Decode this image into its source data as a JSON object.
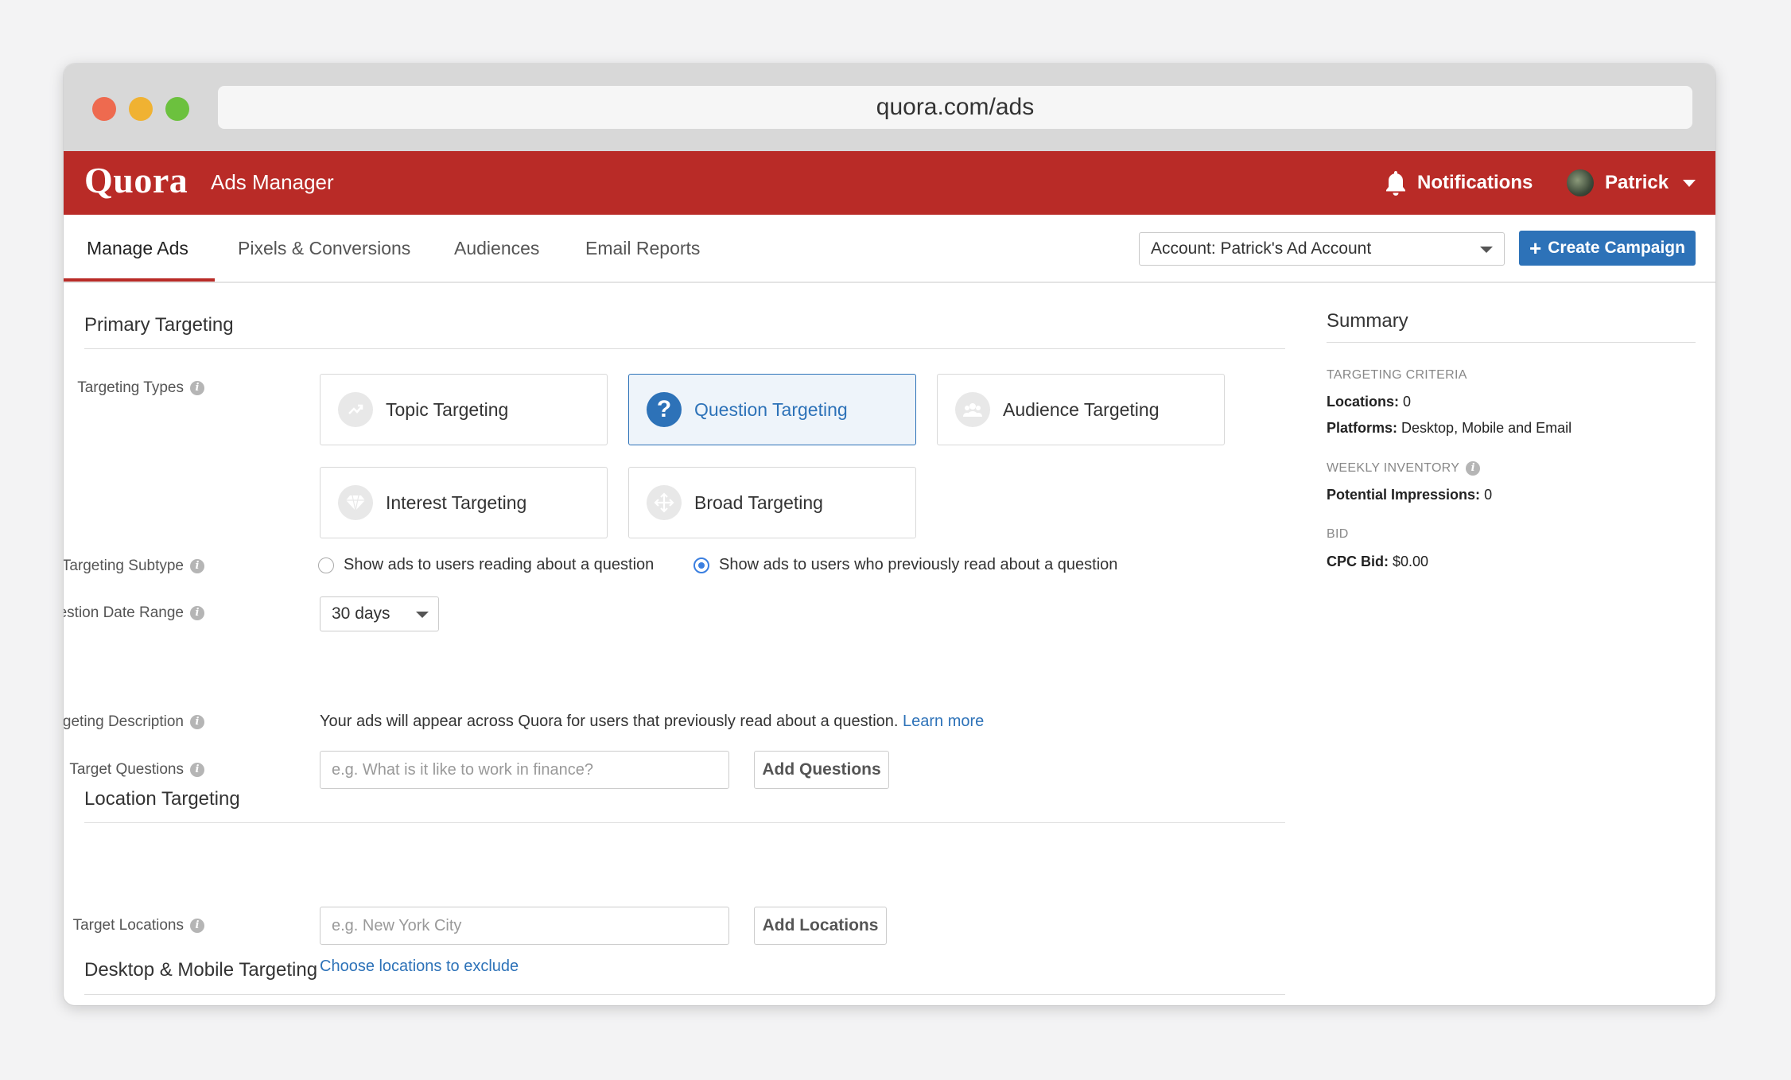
{
  "browser": {
    "url": "quora.com/ads"
  },
  "header": {
    "logo": "Quora",
    "app_name": "Ads Manager",
    "notifications_label": "Notifications",
    "user_name": "Patrick"
  },
  "nav": {
    "tabs": [
      {
        "label": "Manage Ads",
        "active": true
      },
      {
        "label": "Pixels & Conversions"
      },
      {
        "label": "Audiences"
      },
      {
        "label": "Email Reports"
      }
    ],
    "account_select": "Account: Patrick's Ad Account",
    "create_button": "Create Campaign"
  },
  "primary": {
    "title": "Primary Targeting",
    "labels": {
      "types": "Targeting Types",
      "subtype": "Targeting Subtype",
      "date_range": "Question Date Range",
      "description": "Targeting Description",
      "questions": "Target Questions"
    },
    "cards": [
      {
        "label": "Topic Targeting",
        "icon": "trend-icon"
      },
      {
        "label": "Question Targeting",
        "icon": "question-icon",
        "selected": true
      },
      {
        "label": "Audience Targeting",
        "icon": "people-icon"
      },
      {
        "label": "Interest Targeting",
        "icon": "diamond-icon"
      },
      {
        "label": "Broad Targeting",
        "icon": "move-icon"
      }
    ],
    "subtypes": [
      {
        "label": "Show ads to users reading about a question",
        "checked": false
      },
      {
        "label": "Show ads to users who previously read about a question",
        "checked": true
      }
    ],
    "date_range_value": "30 days",
    "description_text": "Your ads will appear across Quora for users that previously read about a question.",
    "learn_more": "Learn more",
    "questions_placeholder": "e.g. What is it like to work in finance?",
    "add_questions": "Add Questions"
  },
  "location": {
    "title": "Location Targeting",
    "label": "Target Locations",
    "placeholder": "e.g. New York City",
    "add_button": "Add Locations",
    "exclude_link": "Choose locations to exclude"
  },
  "desktop_mobile": {
    "title": "Desktop & Mobile Targeting"
  },
  "summary": {
    "title": "Summary",
    "criteria_head": "TARGETING CRITERIA",
    "locations_key": "Locations:",
    "locations_val": "0",
    "platforms_key": "Platforms:",
    "platforms_val": "Desktop, Mobile and Email",
    "inventory_head": "WEEKLY INVENTORY",
    "impressions_key": "Potential Impressions:",
    "impressions_val": "0",
    "bid_head": "BID",
    "cpc_key": "CPC Bid:",
    "cpc_val": "$0.00"
  },
  "colors": {
    "brand": "#b92b27",
    "accent": "#2d72b8"
  }
}
